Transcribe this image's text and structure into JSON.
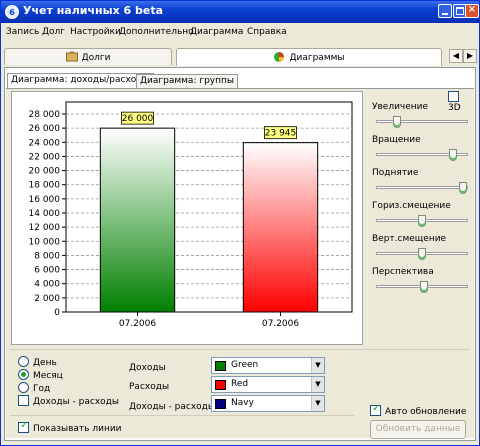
{
  "window": {
    "title": "Учет наличных 6 beta",
    "app_icon": "6"
  },
  "menu": [
    "Запись",
    "Долг",
    "Настройки",
    "Дополнительно",
    "Диаграмма",
    "Справка"
  ],
  "top_tabs": [
    {
      "label": "Долги",
      "icon": "debts-icon"
    },
    {
      "label": "Диаграммы",
      "icon": "charts-icon",
      "active": true
    }
  ],
  "sub_tabs": [
    {
      "label": "Диаграмма: доходы/расходы",
      "active": true
    },
    {
      "label": "Диаграмма: группы"
    }
  ],
  "chart_data": {
    "type": "bar",
    "categories": [
      "07.2006",
      "07.2006"
    ],
    "values": [
      26000,
      23945
    ],
    "labels": [
      "26 000",
      "23 945"
    ],
    "colors": [
      "#008000",
      "#ff0000"
    ],
    "ylim": [
      0,
      28000
    ],
    "yticks": [
      "0",
      "2 000",
      "4 000",
      "6 000",
      "8 000",
      "10 000",
      "12 000",
      "14 000",
      "16 000",
      "18 000",
      "20 000",
      "22 000",
      "24 000",
      "26 000",
      "28 000"
    ],
    "grid": true
  },
  "options": {
    "three_d": {
      "label": "3D",
      "checked": false
    },
    "sliders": [
      {
        "label": "Увеличение",
        "value": 0.2
      },
      {
        "label": "Вращение",
        "value": 0.88
      },
      {
        "label": "Поднятие",
        "value": 1.0
      },
      {
        "label": "Гориз.смещение",
        "value": 0.5
      },
      {
        "label": "Верт.смещение",
        "value": 0.5
      },
      {
        "label": "Перспектива",
        "value": 0.52
      }
    ]
  },
  "period": {
    "day": "День",
    "month": "Месяц",
    "year": "Год",
    "selected": "month",
    "income_minus_expense": {
      "label": "Доходы - расходы",
      "checked": false
    }
  },
  "colors": {
    "income": {
      "label": "Доходы",
      "value": "Green",
      "hex": "#008000"
    },
    "expense": {
      "label": "Расходы",
      "value": "Red",
      "hex": "#ff0000"
    },
    "difference": {
      "label": "Доходы - расходы",
      "value": "Navy",
      "hex": "#000080"
    }
  },
  "show_lines": {
    "label": "Показывать линии",
    "checked": true
  },
  "auto_update": {
    "label": "Авто обновление",
    "checked": true
  },
  "refresh_button": "Обновить данные"
}
